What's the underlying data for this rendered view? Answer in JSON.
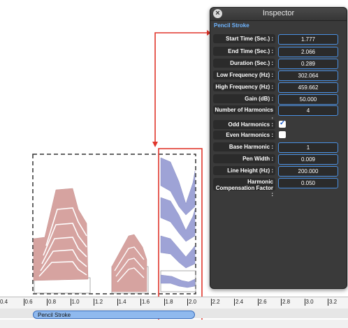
{
  "inspector": {
    "title": "Inspector",
    "section": "Pencil Stroke",
    "fields": [
      {
        "label": "Start Time (Sec.) :",
        "value": "1.777",
        "kind": "text"
      },
      {
        "label": "End Time (Sec.) :",
        "value": "2.066",
        "kind": "text"
      },
      {
        "label": "Duration (Sec.) :",
        "value": "0.289",
        "kind": "text"
      },
      {
        "label": "Low Frequency (Hz) :",
        "value": "302.064",
        "kind": "text"
      },
      {
        "label": "High Frequency (Hz) :",
        "value": "459.662",
        "kind": "text"
      },
      {
        "label": "Gain (dB) :",
        "value": "50.000",
        "kind": "text"
      },
      {
        "label": "Number of Harmonics :",
        "value": "4",
        "kind": "text"
      },
      {
        "label": "Odd Harmonics :",
        "value": true,
        "kind": "check"
      },
      {
        "label": "Even Harmonics :",
        "value": false,
        "kind": "check"
      },
      {
        "label": "Base Harmonic :",
        "value": "1",
        "kind": "text"
      },
      {
        "label": "Pen Width :",
        "value": "0.009",
        "kind": "text"
      },
      {
        "label": "Line Height (Hz) :",
        "value": "200.000",
        "kind": "text"
      },
      {
        "label": "Harmonic Compensation Factor :",
        "value": "0.050",
        "kind": "text"
      }
    ]
  },
  "ruler": {
    "ticks": [
      "0.4",
      "0.6",
      "0.8",
      "1.0",
      "1.2",
      "1.4",
      "1.6",
      "1.8",
      "2.0",
      "2.2",
      "2.4",
      "2.6",
      "2.8",
      "3.0",
      "3.2"
    ]
  },
  "track": {
    "clip_label": "Pencil Stroke"
  },
  "colors": {
    "stroke_red": "#d6a3a0",
    "stroke_blue": "#9ea3d6",
    "highlight": "#e0352b",
    "panel_bg": "#3a3a3a",
    "field_border": "#4a90e2"
  }
}
